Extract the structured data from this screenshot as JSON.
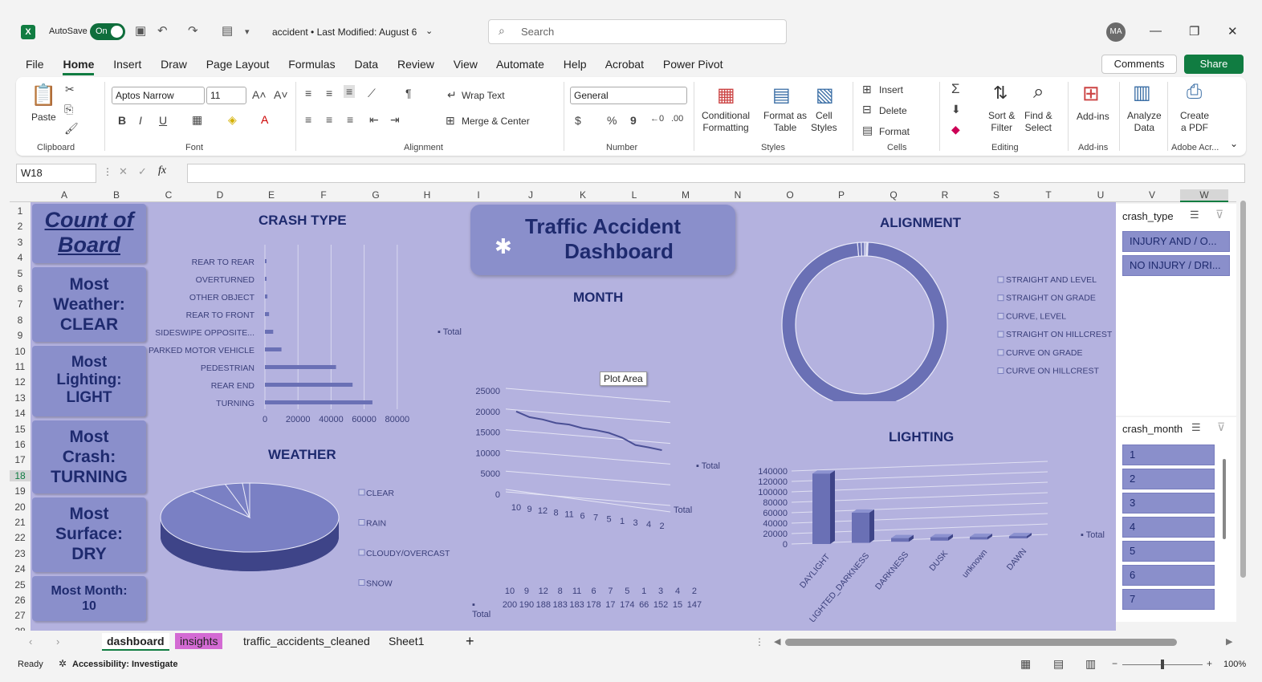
{
  "window": {
    "autosave_label": "AutoSave",
    "autosave_state": "On",
    "doc_title": "accident • Last Modified: August 6",
    "search_placeholder": "Search",
    "user_initials": "MA"
  },
  "menu": {
    "tabs": [
      "File",
      "Home",
      "Insert",
      "Draw",
      "Page Layout",
      "Formulas",
      "Data",
      "Review",
      "View",
      "Automate",
      "Help",
      "Acrobat",
      "Power Pivot"
    ],
    "active": "Home",
    "comments": "Comments",
    "share": "Share"
  },
  "ribbon": {
    "clipboard": {
      "paste": "Paste",
      "label": "Clipboard"
    },
    "font": {
      "name": "Aptos Narrow",
      "size": "11",
      "label": "Font"
    },
    "alignment": {
      "wrap": "Wrap Text",
      "merge": "Merge & Center",
      "label": "Alignment"
    },
    "number": {
      "format": "General",
      "label": "Number"
    },
    "styles": {
      "cond1": "Conditional",
      "cond2": "Formatting",
      "fmt1": "Format as",
      "fmt2": "Table",
      "cell1": "Cell",
      "cell2": "Styles",
      "label": "Styles"
    },
    "cells": {
      "insert": "Insert",
      "delete": "Delete",
      "format": "Format",
      "label": "Cells"
    },
    "editing": {
      "sort1": "Sort &",
      "sort2": "Filter",
      "find1": "Find &",
      "find2": "Select",
      "label": "Editing"
    },
    "addins": {
      "btn": "Add-ins",
      "label": "Add-ins"
    },
    "analyze": {
      "l1": "Analyze",
      "l2": "Data"
    },
    "pdf": {
      "l1": "Create",
      "l2": "a PDF",
      "label": "Adobe Acr..."
    }
  },
  "formula_bar": {
    "name_box": "W18",
    "fx": "fx"
  },
  "columns": [
    "A",
    "B",
    "C",
    "D",
    "E",
    "F",
    "G",
    "H",
    "I",
    "J",
    "K",
    "L",
    "M",
    "N",
    "O",
    "P",
    "Q",
    "R",
    "S",
    "T",
    "U",
    "V",
    "W"
  ],
  "rows": [
    "1",
    "2",
    "3",
    "4",
    "5",
    "6",
    "7",
    "8",
    "9",
    "10",
    "11",
    "12",
    "13",
    "14",
    "15",
    "16",
    "17",
    "18",
    "19",
    "20",
    "21",
    "22",
    "23",
    "24",
    "25",
    "26",
    "27",
    "28"
  ],
  "cards": {
    "title1": "Count of",
    "title2": "Board",
    "weather": [
      "Most",
      "Weather:",
      "CLEAR"
    ],
    "lighting": [
      "Most",
      "Lighting:",
      "LIGHT"
    ],
    "crash": [
      "Most",
      "Crash:",
      "TURNING"
    ],
    "surface": [
      "Most",
      "Surface:",
      "DRY"
    ],
    "month": [
      "Most Month:",
      "10"
    ]
  },
  "banner": {
    "line1": "Traffic Accident",
    "line2": "Dashboard"
  },
  "chart_data": [
    {
      "type": "bar",
      "title": "CRASH TYPE",
      "categories": [
        "REAR TO REAR",
        "OVERTURNED",
        "OTHER OBJECT",
        "REAR TO FRONT",
        "SIDESWIPE OPPOSITE...",
        "PARKED MOTOR VEHICLE",
        "PEDESTRIAN",
        "REAR END",
        "TURNING"
      ],
      "series": [
        {
          "name": "Total",
          "values": [
            300,
            800,
            1000,
            1500,
            2500,
            5000,
            10000,
            43000,
            53000,
            65000
          ]
        }
      ],
      "xticks": [
        "0",
        "20000",
        "40000",
        "60000",
        "80000"
      ],
      "xlim": [
        0,
        80000
      ]
    },
    {
      "type": "pie",
      "title": "WEATHER",
      "categories": [
        "CLEAR",
        "RAIN",
        "CLOUDY/OVERCAST",
        "SNOW"
      ],
      "values": [
        171000,
        13000,
        6000,
        2500
      ]
    },
    {
      "type": "line",
      "title": "MONTH",
      "categories": [
        "10",
        "9",
        "12",
        "8",
        "11",
        "6",
        "7",
        "5",
        "1",
        "3",
        "4",
        "2"
      ],
      "series": [
        {
          "name": "Total",
          "values": [
            20000,
            19000,
            18800,
            18300,
            18300,
            17800,
            17700,
            17400,
            16600,
            15200,
            15000,
            14700
          ]
        }
      ],
      "yticks": [
        "25000",
        "20000",
        "15000",
        "10000",
        "5000",
        "0"
      ],
      "ylim": [
        0,
        25000
      ],
      "table": {
        "header": [
          "10",
          "9",
          "12",
          "8",
          "11",
          "6",
          "7",
          "5",
          "1",
          "3",
          "4",
          "2"
        ],
        "row_label": "Total",
        "values": [
          "200",
          "190",
          "188",
          "183",
          "183",
          "178",
          "17",
          "174",
          "66",
          "152",
          "15",
          "147"
        ]
      }
    },
    {
      "type": "pie",
      "title": "ALIGNMENT",
      "categories": [
        "STRAIGHT AND LEVEL",
        "STRAIGHT ON GRADE",
        "CURVE, LEVEL",
        "STRAIGHT ON HILLCREST",
        "CURVE ON GRADE",
        "CURVE ON HILLCREST"
      ],
      "values": [
        205000,
        1500,
        1300,
        700,
        500,
        200
      ]
    },
    {
      "type": "bar",
      "title": "LIGHTING",
      "categories": [
        "DAYLIGHT",
        "LIGHTED_DARKNESS",
        "DARKNESS",
        "DUSK",
        "unknown",
        "DAWN"
      ],
      "series": [
        {
          "name": "Total",
          "values": [
            135000,
            58000,
            7000,
            6500,
            5000,
            4500
          ]
        }
      ],
      "yticks": [
        "140000",
        "120000",
        "100000",
        "80000",
        "60000",
        "40000",
        "20000",
        "0"
      ],
      "ylim": [
        0,
        140000
      ]
    }
  ],
  "plot_area_tooltip": "Plot Area",
  "total_label": "Total",
  "slicers": {
    "crash_type": {
      "title": "crash_type",
      "items": [
        "INJURY AND / O...",
        "NO INJURY / DRI..."
      ]
    },
    "crash_month": {
      "title": "crash_month",
      "items": [
        "1",
        "2",
        "3",
        "4",
        "5",
        "6",
        "7"
      ]
    }
  },
  "sheets": {
    "tabs": [
      "dashboard",
      "insights",
      "traffic_accidents_cleaned",
      "Sheet1"
    ],
    "active": "dashboard"
  },
  "status": {
    "ready": "Ready",
    "accessibility": "Accessibility: Investigate",
    "zoom": "100%"
  },
  "colors": {
    "dash_bg": "#b4b2df",
    "card": "#8a8fcb",
    "text_dark": "#1e2a6e",
    "bar": "#6a70b5",
    "excel_green": "#107c41",
    "insights_tab": "#d36ad3"
  }
}
